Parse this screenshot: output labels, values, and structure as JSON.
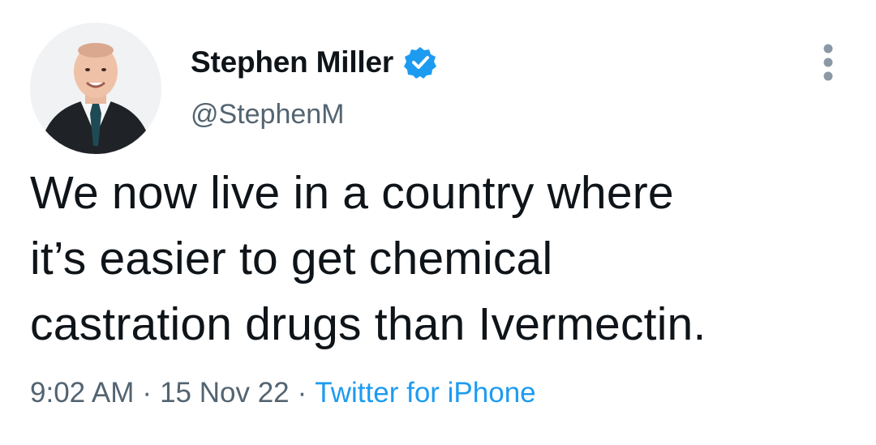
{
  "author": {
    "display_name": "Stephen Miller",
    "handle": "@StephenM",
    "verified": true,
    "avatar_icon": "profile-photo-avatar",
    "verified_icon": "verified-badge-icon"
  },
  "tweet": {
    "lines": [
      "We now live in a country where",
      "it’s easier to get chemical",
      "castration drugs than Ivermectin."
    ]
  },
  "meta": {
    "time": "9:02 AM",
    "separator": "·",
    "date": "15 Nov 22",
    "source": "Twitter for iPhone"
  },
  "menu": {
    "icon": "more-vertical-icon"
  },
  "colors": {
    "text_primary": "#0f1419",
    "text_secondary": "#536471",
    "accent": "#1d9bf0"
  }
}
